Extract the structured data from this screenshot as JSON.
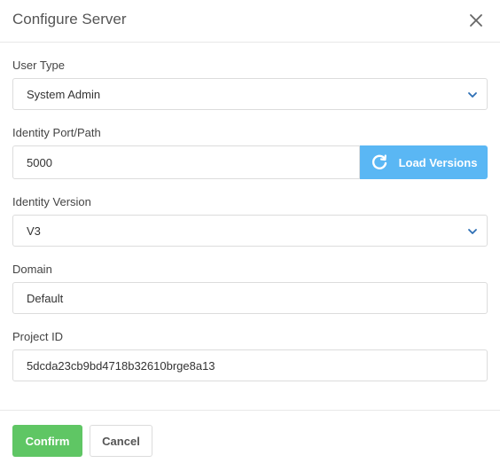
{
  "dialog": {
    "title": "Configure Server",
    "close_icon": "close-icon"
  },
  "form": {
    "user_type": {
      "label": "User Type",
      "value": "System Admin"
    },
    "identity_port": {
      "label": "Identity Port/Path",
      "value": "5000"
    },
    "load_versions": {
      "label": "Load Versions",
      "icon": "refresh-icon"
    },
    "identity_version": {
      "label": "Identity Version",
      "value": "V3"
    },
    "domain": {
      "label": "Domain",
      "value": "Default"
    },
    "project_id": {
      "label": "Project ID",
      "value": "5dcda23cb9bd4718b32610brge8a13"
    }
  },
  "footer": {
    "confirm_label": "Confirm",
    "cancel_label": "Cancel"
  },
  "colors": {
    "accent_blue": "#5ab7f4",
    "confirm_green": "#5fc664",
    "chevron_blue": "#2d6fb5"
  }
}
